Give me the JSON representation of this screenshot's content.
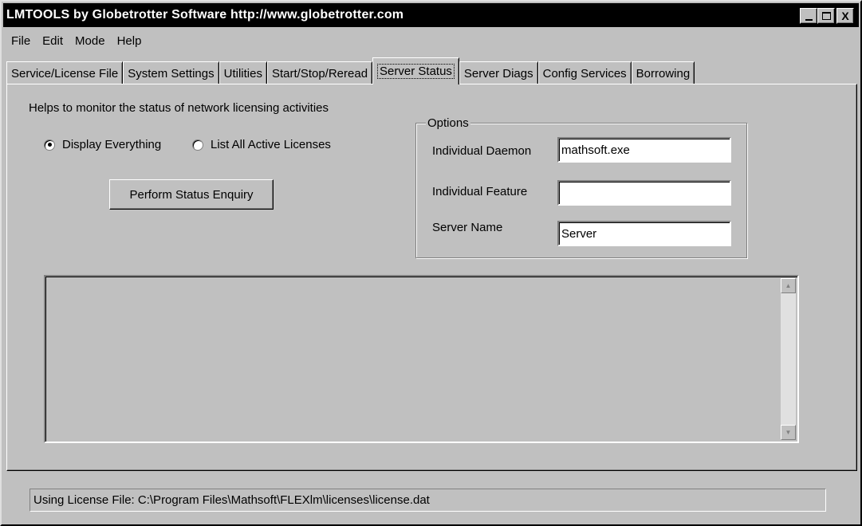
{
  "window": {
    "title": "LMTOOLS by Globetrotter Software http://www.globetrotter.com",
    "minimize_glyph": "_",
    "close_glyph": "X"
  },
  "menu": [
    "File",
    "Edit",
    "Mode",
    "Help"
  ],
  "tabs": [
    {
      "label": "Service/License File",
      "active": false
    },
    {
      "label": "System Settings",
      "active": false
    },
    {
      "label": "Utilities",
      "active": false
    },
    {
      "label": "Start/Stop/Reread",
      "active": false
    },
    {
      "label": "Server Status",
      "active": true
    },
    {
      "label": "Server Diags",
      "active": false
    },
    {
      "label": "Config Services",
      "active": false
    },
    {
      "label": "Borrowing",
      "active": false
    }
  ],
  "page": {
    "help_text": "Helps to monitor the status of network licensing activities",
    "radio_display_everything": "Display Everything",
    "radio_list_active": "List All Active Licenses",
    "selected_radio": "Display Everything",
    "status_button": "Perform Status Enquiry"
  },
  "options": {
    "title": "Options",
    "daemon_label": "Individual Daemon",
    "daemon_value": "mathsoft.exe",
    "feature_label": "Individual Feature",
    "feature_value": "",
    "server_label": "Server Name",
    "server_value": "Server"
  },
  "output": {
    "text": ""
  },
  "statusbar": {
    "text": "Using License File:  C:\\Program Files\\Mathsoft\\FLEXlm\\licenses\\license.dat"
  }
}
